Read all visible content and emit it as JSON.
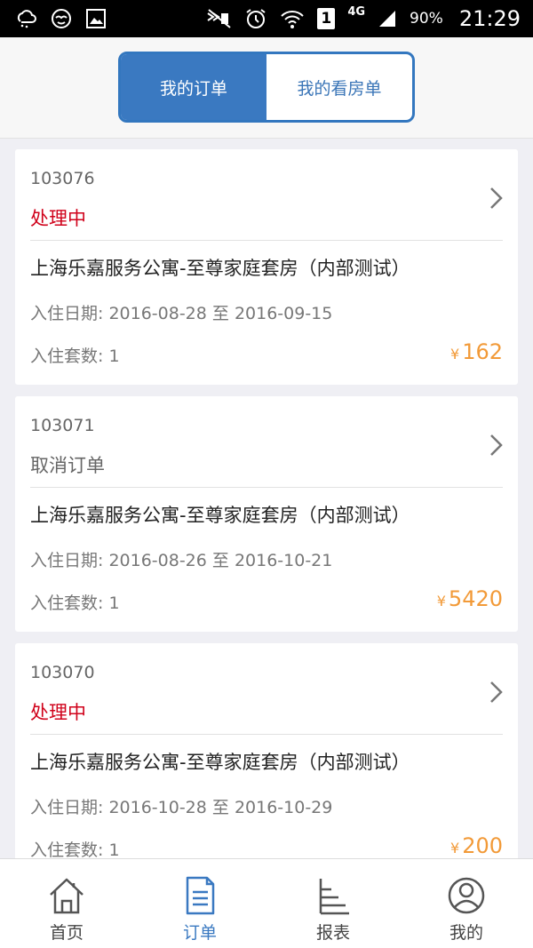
{
  "status_bar": {
    "sim_number": "1",
    "network": "4G",
    "battery": "90%",
    "time": "21:29",
    "icons": [
      "weather-icon",
      "face-icon",
      "image-icon",
      "mute-icon",
      "alarm-icon",
      "wifi-icon",
      "signal-icon"
    ]
  },
  "header": {
    "tabs": [
      {
        "label": "我的订单",
        "active": true
      },
      {
        "label": "我的看房单",
        "active": false
      }
    ]
  },
  "orders": [
    {
      "number": "103076",
      "status": "处理中",
      "title": "上海乐嘉服务公寓-至尊家庭套房（内部测试）",
      "dates": "入住日期: 2016-08-28 至 2016-09-15",
      "count": "入住套数: 1",
      "currency": "¥",
      "amount": "162"
    },
    {
      "number": "103071",
      "status": "取消订单",
      "title": "上海乐嘉服务公寓-至尊家庭套房（内部测试）",
      "dates": "入住日期: 2016-08-26 至 2016-10-21",
      "count": "入住套数: 1",
      "currency": "¥",
      "amount": "5420"
    },
    {
      "number": "103070",
      "status": "处理中",
      "title": "上海乐嘉服务公寓-至尊家庭套房（内部测试）",
      "dates": "入住日期: 2016-10-28 至 2016-10-29",
      "count": "入住套数: 1",
      "currency": "¥",
      "amount": "200"
    }
  ],
  "tabbar": {
    "items": [
      {
        "label": "首页",
        "icon": "home-icon",
        "active": false
      },
      {
        "label": "订单",
        "icon": "order-icon",
        "active": true
      },
      {
        "label": "报表",
        "icon": "report-icon",
        "active": false
      },
      {
        "label": "我的",
        "icon": "profile-icon",
        "active": false
      }
    ]
  },
  "colors": {
    "accent": "#3a79c1",
    "status_processing": "#d0021b",
    "status_cancelled": "#666666",
    "price": "#f29a38"
  }
}
